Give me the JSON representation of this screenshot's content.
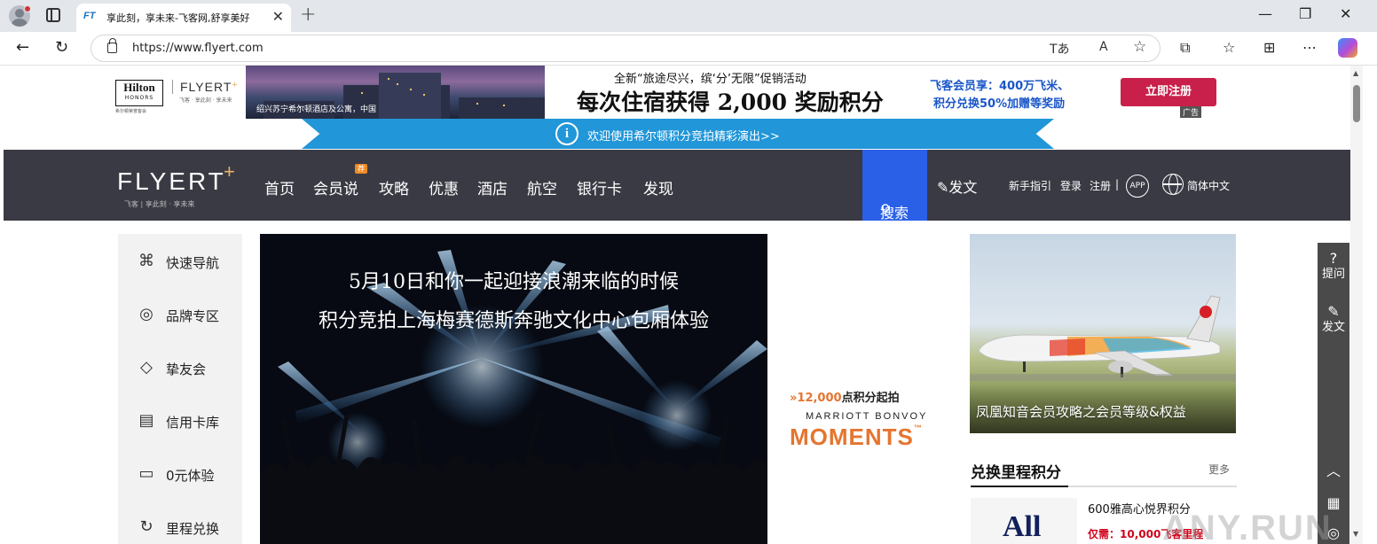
{
  "browser": {
    "tab_title": "享此刻，享未来-飞客网,舒享美好",
    "tab_favicon_text": "FT",
    "url": "https://www.flyert.com",
    "icons": {
      "back": "back-arrow-icon",
      "reload": "reload-icon",
      "site_info": "lock-icon",
      "read_aloud": "read-aloud-icon",
      "favorite": "star-icon",
      "extensions": "puzzle-icon",
      "favorites": "favorites-icon",
      "collections": "collections-icon",
      "more": "ellipsis-icon",
      "copilot": "copilot-icon"
    },
    "reader_text": "Tあ",
    "read_aloud_text": "A"
  },
  "ad_banner": {
    "hilton_brand": "Hilton",
    "hilton_sub": "HONORS",
    "hilton_tag": "希尔顿荣誉客会",
    "flyert_brand": "FLYERT",
    "flyert_tagline": "飞客 · 享此刻 · 享未来",
    "photo_caption": "绍兴苏宁希尔顿酒店及公寓，中国",
    "promo_line1": "全新“旅途尽兴，缤‘分’无限”促销活动",
    "promo_line2": "每次住宿获得 2,000 奖励积分",
    "right_line1": "飞客会员享：400万飞米、",
    "right_line2": "积分兑换50%加赠等奖励",
    "register_button": "立即注册",
    "ad_label": "广告"
  },
  "notice": {
    "icon": "info-icon",
    "text": "欢迎使用希尔顿积分竞拍精彩演出>>"
  },
  "nav": {
    "logo": "FLYERT",
    "logo_plus": "+",
    "logo_sub": "飞客 | 享此刻 · 享未来",
    "items": [
      {
        "label": "首页"
      },
      {
        "label": "会员说"
      },
      {
        "label": "攻略"
      },
      {
        "label": "优惠"
      },
      {
        "label": "酒店"
      },
      {
        "label": "航空"
      },
      {
        "label": "银行卡"
      },
      {
        "label": "发现"
      }
    ],
    "badge": "荐",
    "search_label": "搜索",
    "post_label": "发文",
    "guide": "新手指引",
    "login": "登录",
    "register": "注册",
    "divider": "|",
    "app": "APP",
    "language": "简体中文"
  },
  "left_menu": [
    {
      "label": "快速导航",
      "icon": "quick-nav-icon",
      "glyph": "⌘"
    },
    {
      "label": "品牌专区",
      "icon": "brand-icon",
      "glyph": "◎"
    },
    {
      "label": "挚友会",
      "icon": "diamond-icon",
      "glyph": "◇"
    },
    {
      "label": "信用卡库",
      "icon": "credit-card-icon",
      "glyph": "▤"
    },
    {
      "label": "0元体验",
      "icon": "bed-icon",
      "glyph": "▭"
    },
    {
      "label": "里程兑换",
      "icon": "exchange-icon",
      "glyph": "↻"
    }
  ],
  "hero": {
    "title_line1": "5月10日和你一起迎接浪潮来临的时候",
    "title_line2": "积分竞拍上海梅赛德斯奔驰文化中心包厢体验"
  },
  "marriott_ad": {
    "prefix": "»",
    "points": "12,000",
    "points_suffix": "点积分起拍",
    "brand": "MARRIOTT BONVOY",
    "moments": "MOMENTS",
    "tm": "™"
  },
  "right_card": {
    "caption": "凤凰知音会员攻略之会员等级&权益"
  },
  "exchange": {
    "title": "兑换里程积分",
    "more": "更多",
    "logo_text": "All",
    "offer_name": "600雅高心悦界积分",
    "offer_price": "仅需：10,000飞客里程"
  },
  "float_bar": {
    "ask": "提问",
    "ask_icon": "question-icon",
    "post": "发文",
    "post_icon": "pencil-icon",
    "top_icon": "chevron-up-icon",
    "qr_icon": "qr-code-icon",
    "service_icon": "headset-icon"
  },
  "watermark": "ANY.RUN",
  "colors": {
    "nav_bg": "#3a3a44",
    "search_bg": "#2a60e8",
    "notice_bg": "#2196d8",
    "register_bg": "#c8204a",
    "marriott_orange": "#e5752f",
    "price_red": "#d0021b"
  }
}
